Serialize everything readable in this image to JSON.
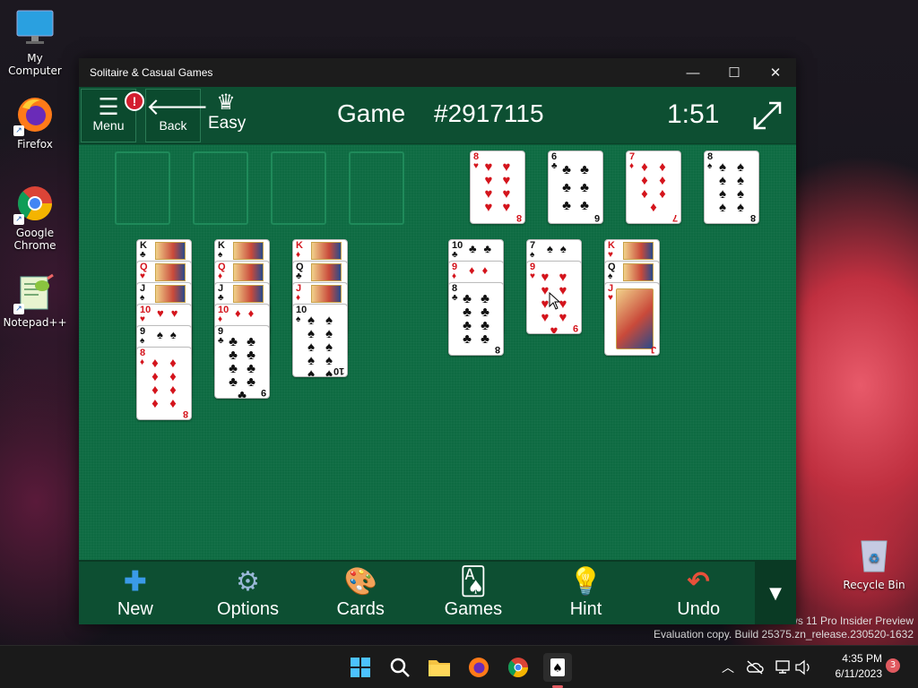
{
  "desktop": {
    "icons": [
      {
        "label": "My Computer"
      },
      {
        "label": "Firefox"
      },
      {
        "label": "Google Chrome"
      },
      {
        "label": "Notepad++"
      },
      {
        "label": "Recycle Bin"
      }
    ],
    "watermark_line1": "ws 11 Pro Insider Preview",
    "watermark_line2": "Evaluation copy. Build 25375.zn_release.230520-1632"
  },
  "window": {
    "title": "Solitaire & Casual Games",
    "minimize": "—",
    "maximize": "☐",
    "close": "✕"
  },
  "header": {
    "menu_label": "Menu",
    "menu_badge": "!",
    "back_label": "Back",
    "difficulty": "Easy",
    "game_label": "Game",
    "game_number": "#2917115",
    "timer": "1:51"
  },
  "foundations": [
    {
      "rank": "8",
      "suit": "♥",
      "color": "red"
    },
    {
      "rank": "6",
      "suit": "♣",
      "color": "black"
    },
    {
      "rank": "7",
      "suit": "♦",
      "color": "red"
    },
    {
      "rank": "8",
      "suit": "♠",
      "color": "black"
    }
  ],
  "tableau": [
    [
      {
        "rank": "K",
        "suit": "♣",
        "color": "black"
      },
      {
        "rank": "Q",
        "suit": "♥",
        "color": "red"
      },
      {
        "rank": "J",
        "suit": "♠",
        "color": "black"
      },
      {
        "rank": "10",
        "suit": "♥",
        "color": "red"
      },
      {
        "rank": "9",
        "suit": "♠",
        "color": "black"
      },
      {
        "rank": "8",
        "suit": "♦",
        "color": "red"
      }
    ],
    [
      {
        "rank": "K",
        "suit": "♠",
        "color": "black"
      },
      {
        "rank": "Q",
        "suit": "♦",
        "color": "red"
      },
      {
        "rank": "J",
        "suit": "♣",
        "color": "black"
      },
      {
        "rank": "10",
        "suit": "♦",
        "color": "red"
      },
      {
        "rank": "9",
        "suit": "♣",
        "color": "black"
      }
    ],
    [
      {
        "rank": "K",
        "suit": "♦",
        "color": "red"
      },
      {
        "rank": "Q",
        "suit": "♣",
        "color": "black"
      },
      {
        "rank": "J",
        "suit": "♦",
        "color": "red"
      },
      {
        "rank": "10",
        "suit": "♠",
        "color": "black"
      }
    ],
    [],
    [
      {
        "rank": "10",
        "suit": "♣",
        "color": "black"
      },
      {
        "rank": "9",
        "suit": "♦",
        "color": "red"
      },
      {
        "rank": "8",
        "suit": "♣",
        "color": "black"
      }
    ],
    [
      {
        "rank": "7",
        "suit": "♠",
        "color": "black"
      },
      {
        "rank": "9",
        "suit": "♥",
        "color": "red"
      }
    ],
    [
      {
        "rank": "K",
        "suit": "♥",
        "color": "red"
      },
      {
        "rank": "Q",
        "suit": "♠",
        "color": "black"
      },
      {
        "rank": "J",
        "suit": "♥",
        "color": "red"
      }
    ]
  ],
  "toolbar": {
    "new_label": "New",
    "options_label": "Options",
    "cards_label": "Cards",
    "games_label": "Games",
    "hint_label": "Hint",
    "undo_label": "Undo"
  },
  "taskbar": {
    "time": "4:35 PM",
    "date": "6/11/2023",
    "notification_count": "3"
  },
  "colors": {
    "felt": "#0e6b42",
    "red_suit": "#d4141c",
    "badge": "#d31e2f"
  }
}
